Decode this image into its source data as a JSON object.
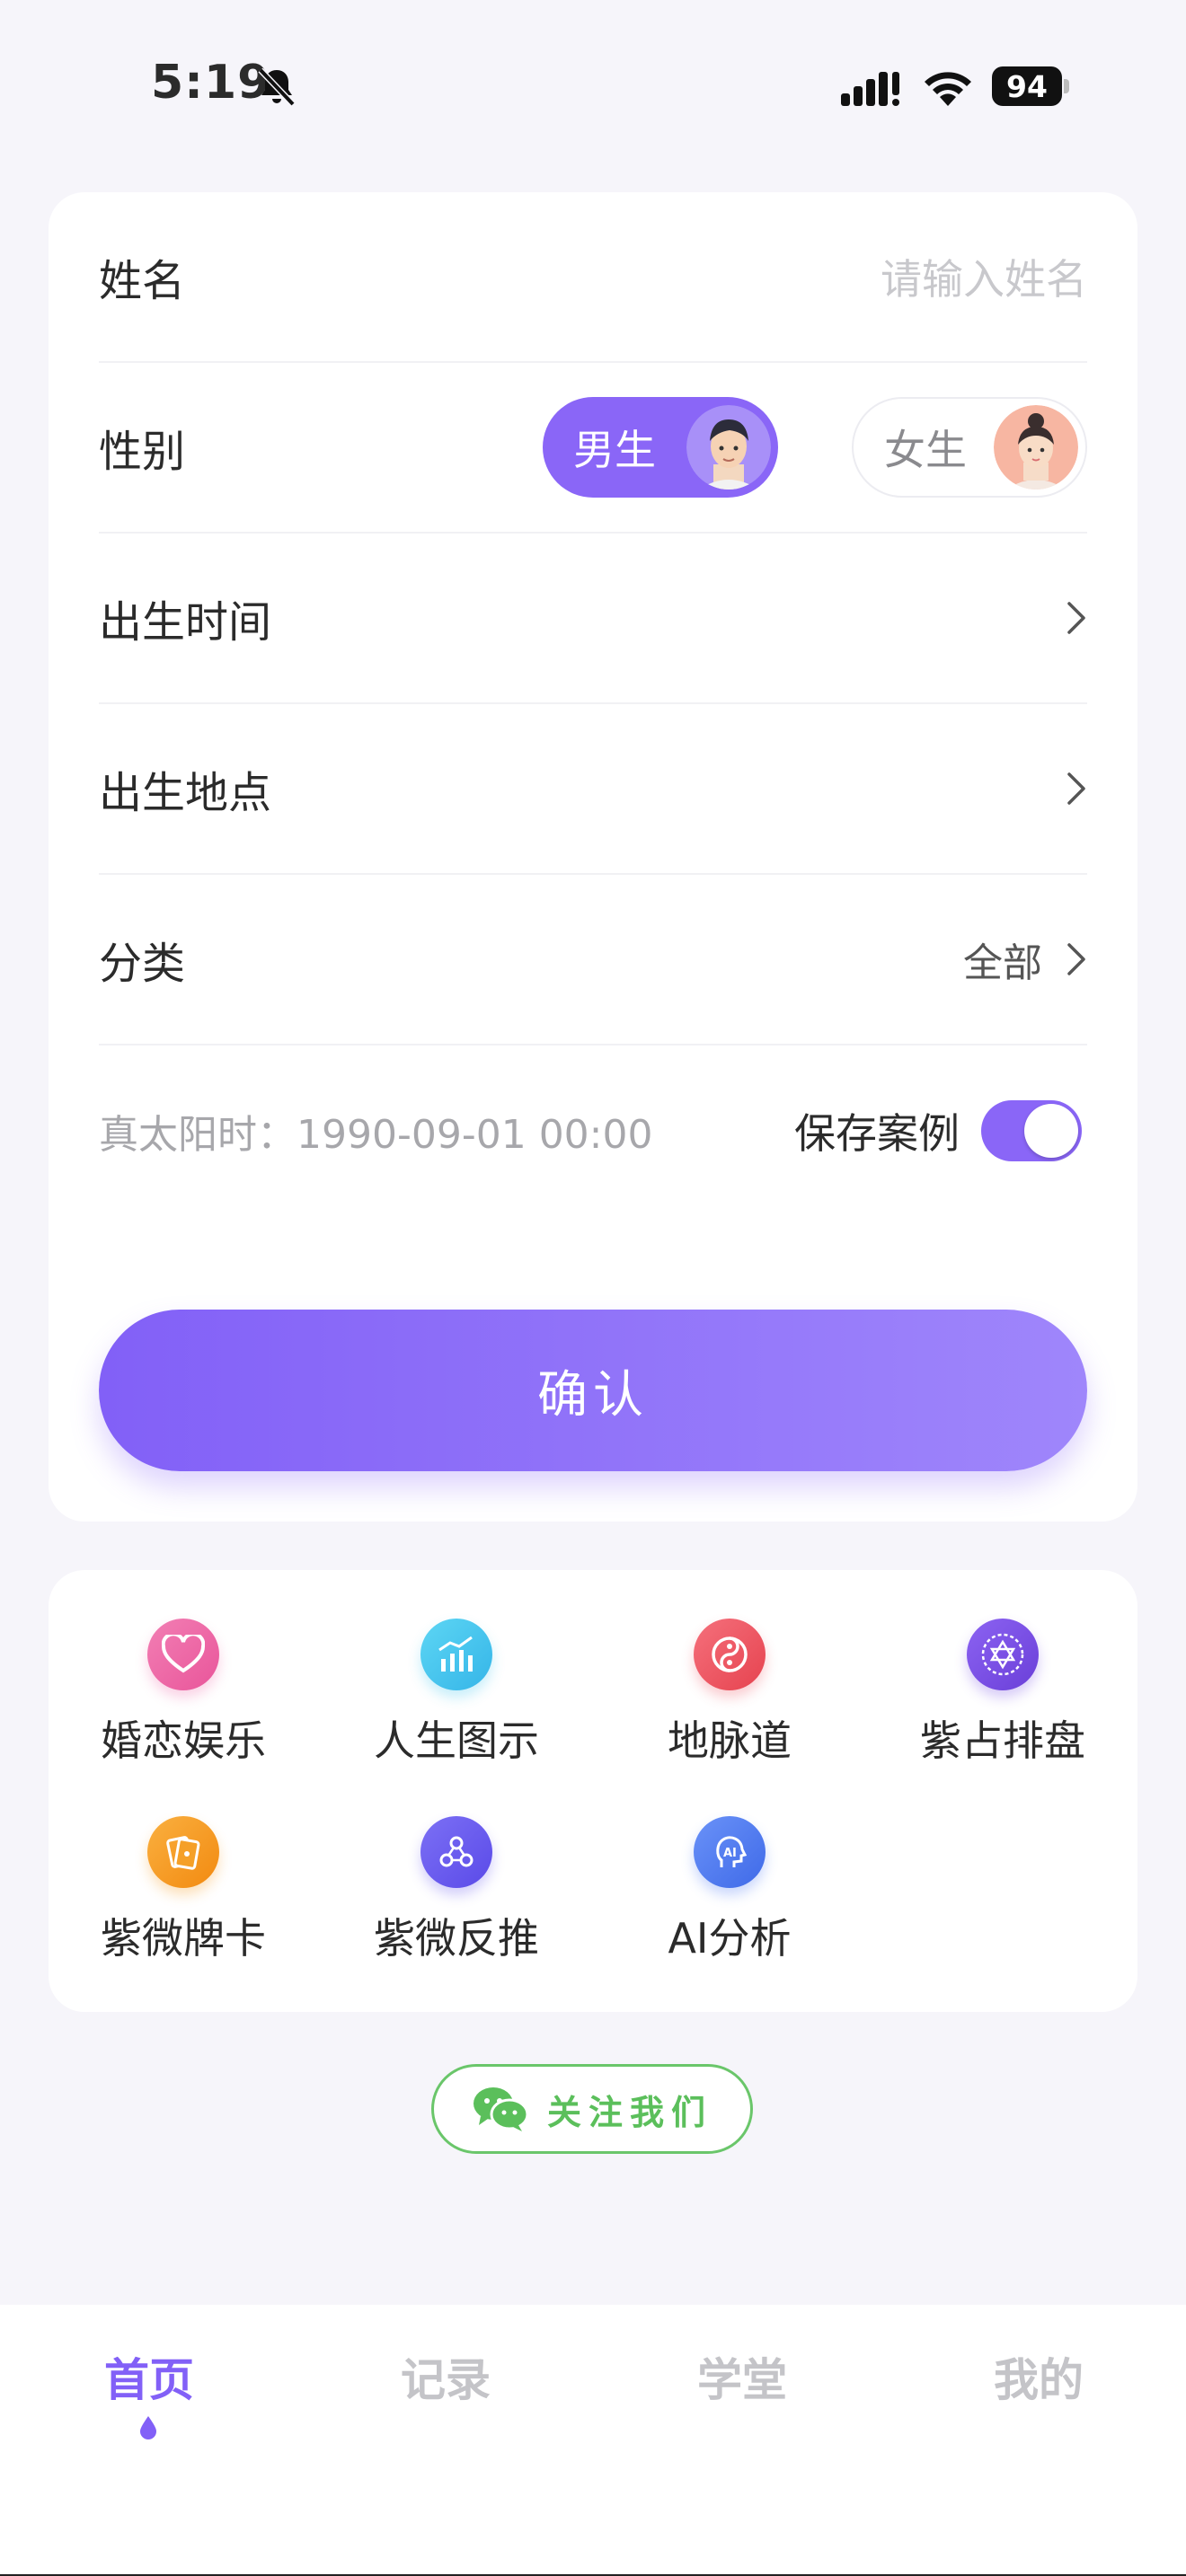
{
  "status_bar": {
    "time": "5:19",
    "battery": "94"
  },
  "form": {
    "name": {
      "label": "姓名",
      "placeholder": "请输入姓名"
    },
    "gender": {
      "label": "性别",
      "male": "男生",
      "female": "女生",
      "selected": "男生"
    },
    "birth_time": {
      "label": "出生时间"
    },
    "birth_place": {
      "label": "出生地点"
    },
    "category": {
      "label": "分类",
      "value": "全部"
    },
    "solar_time": "真太阳时：1990-09-01 00:00",
    "save_case": {
      "label": "保存案例",
      "on": true
    },
    "confirm": "确认"
  },
  "features": [
    {
      "label": "婚恋娱乐",
      "icon": "heart-icon",
      "color": "#ef6aa8"
    },
    {
      "label": "人生图示",
      "icon": "chart-icon",
      "color": "#47c7ee"
    },
    {
      "label": "地脉道",
      "icon": "yinyang-icon",
      "color": "#f05a67"
    },
    {
      "label": "紫占排盘",
      "icon": "star-plate-icon",
      "color": "#7a52e6"
    },
    {
      "label": "紫微牌卡",
      "icon": "cards-icon",
      "color": "#f59b22"
    },
    {
      "label": "紫微反推",
      "icon": "nodes-icon",
      "color": "#6b5df0"
    },
    {
      "label": "AI分析",
      "icon": "ai-head-icon",
      "color": "#4f7cf6"
    }
  ],
  "follow_us": "关注我们",
  "tabs": [
    {
      "label": "首页",
      "active": true
    },
    {
      "label": "记录",
      "active": false
    },
    {
      "label": "学堂",
      "active": false
    },
    {
      "label": "我的",
      "active": false
    }
  ],
  "colors": {
    "accent": "#8a66f7",
    "wechat": "#5bbf5b"
  }
}
